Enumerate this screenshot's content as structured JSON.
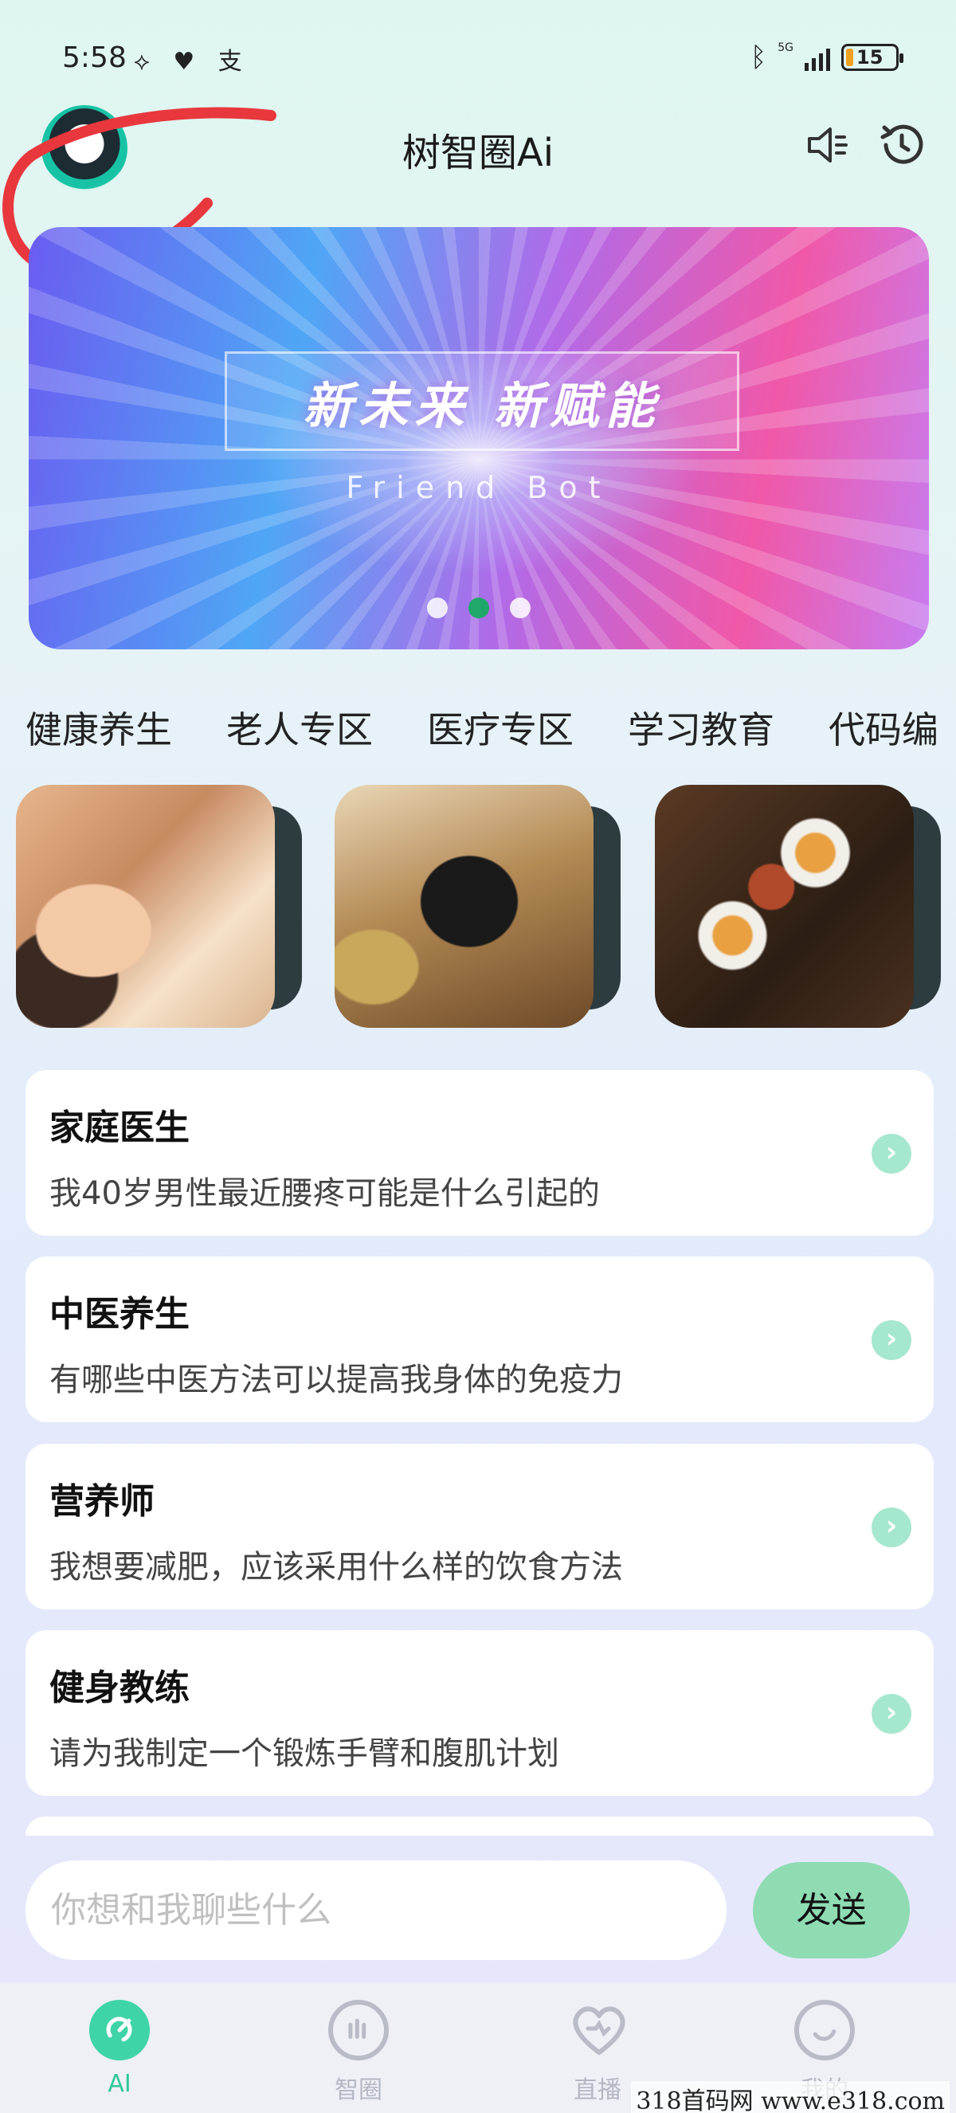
{
  "status_bar": {
    "time": "5:58",
    "left_icons": "⟡ ♥ 支",
    "network_label": "5G",
    "battery": "15",
    "battery_level_percent": 15
  },
  "header": {
    "title": "树智圈Ai",
    "avatar_icon": "robot-panda-avatar",
    "speaker_icon": "speaker-icon",
    "history_icon": "history-icon"
  },
  "banner": {
    "heading": "新未来  新赋能",
    "subtitle": "Friend Bot",
    "dots": 3,
    "active_dot": 2
  },
  "tabs": [
    {
      "label": "健康养生",
      "active": true
    },
    {
      "label": "老人专区",
      "active": false
    },
    {
      "label": "医疗专区",
      "active": false
    },
    {
      "label": "学习教育",
      "active": false
    },
    {
      "label": "代码编",
      "active": false
    }
  ],
  "image_cards": [
    "massage-photo",
    "herbal-teapot-photo",
    "tea-set-photo"
  ],
  "prompts": [
    {
      "title": "家庭医生",
      "text": "我40岁男性最近腰疼可能是什么引起的"
    },
    {
      "title": "中医养生",
      "text": "有哪些中医方法可以提高我身体的免疫力"
    },
    {
      "title": "营养师",
      "text": "我想要减肥，应该采用什么样的饮食方法"
    },
    {
      "title": "健身教练",
      "text": "请为我制定一个锻炼手臂和腹肌计划"
    }
  ],
  "chat": {
    "placeholder": "你想和我聊些什么",
    "send_label": "发送"
  },
  "bottom_nav": [
    {
      "label": "AI",
      "icon": "ai-icon",
      "active": true
    },
    {
      "label": "智圈",
      "icon": "circle-bars-icon",
      "active": false
    },
    {
      "label": "直播",
      "icon": "heart-icon",
      "active": false
    },
    {
      "label": "我的",
      "icon": "profile-icon",
      "active": false
    }
  ],
  "watermark": "318首码网 www.e318.com",
  "colors": {
    "accent": "#3fd3a8",
    "send_button": "#8fdcb3",
    "scribble": "#e8383d"
  }
}
